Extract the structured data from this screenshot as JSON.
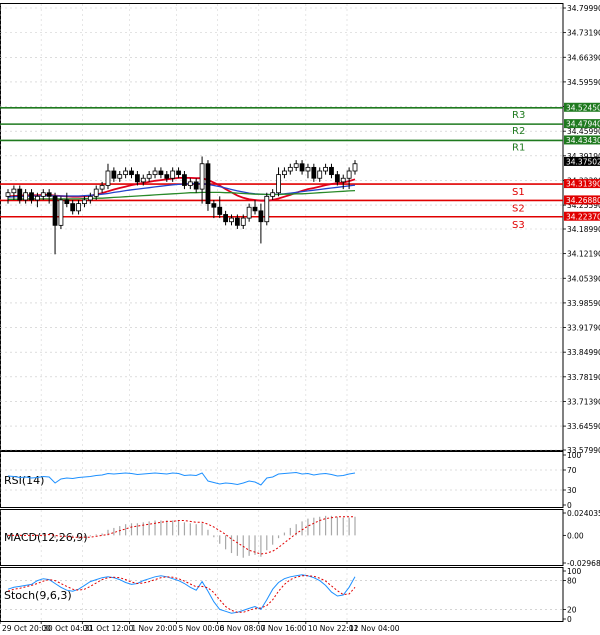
{
  "chart_data": [
    {
      "type": "candlestick",
      "pane": "price",
      "ylim": [
        33.5799,
        34.7999
      ],
      "y_ticks": [
        "34.79990",
        "34.73190",
        "34.66390",
        "34.59590",
        "34.52790",
        "34.45990",
        "34.39190",
        "34.32390",
        "34.25590",
        "34.18990",
        "34.12190",
        "34.05390",
        "33.98590",
        "33.91790",
        "33.84990",
        "33.78190",
        "33.71390",
        "33.64590",
        "33.57990"
      ],
      "x_ticks": [
        "29 Oct 20:00",
        "30 Oct 04:00",
        "31 Oct 12:00",
        "1 Nov 20:00",
        "5 Nov 00:00",
        "6 Nov 08:00",
        "7 Nov 16:00",
        "10 Nov 22:01",
        "12 Nov 04:00"
      ],
      "current_price": "34.37502",
      "candles": [
        [
          34.28,
          34.3,
          34.26,
          34.29
        ],
        [
          34.29,
          34.31,
          34.27,
          34.3
        ],
        [
          34.3,
          34.31,
          34.26,
          34.27
        ],
        [
          34.27,
          34.3,
          34.26,
          34.29
        ],
        [
          34.29,
          34.3,
          34.26,
          34.27
        ],
        [
          34.27,
          34.29,
          34.25,
          34.28
        ],
        [
          34.28,
          34.3,
          34.27,
          34.29
        ],
        [
          34.29,
          34.3,
          34.26,
          34.28
        ],
        [
          34.28,
          34.29,
          34.12,
          34.2
        ],
        [
          34.2,
          34.28,
          34.19,
          34.27
        ],
        [
          34.27,
          34.29,
          34.25,
          34.26
        ],
        [
          34.26,
          34.27,
          34.23,
          34.24
        ],
        [
          34.24,
          34.27,
          34.23,
          34.26
        ],
        [
          34.26,
          34.28,
          34.25,
          34.27
        ],
        [
          34.27,
          34.29,
          34.26,
          34.28
        ],
        [
          34.28,
          34.31,
          34.27,
          34.3
        ],
        [
          34.3,
          34.32,
          34.29,
          34.31
        ],
        [
          34.31,
          34.37,
          34.3,
          34.35
        ],
        [
          34.35,
          34.36,
          34.32,
          34.33
        ],
        [
          34.33,
          34.35,
          34.32,
          34.34
        ],
        [
          34.34,
          34.36,
          34.33,
          34.35
        ],
        [
          34.35,
          34.36,
          34.33,
          34.34
        ],
        [
          34.34,
          34.35,
          34.31,
          34.32
        ],
        [
          34.32,
          34.34,
          34.31,
          34.33
        ],
        [
          34.33,
          34.35,
          34.32,
          34.34
        ],
        [
          34.34,
          34.36,
          34.33,
          34.35
        ],
        [
          34.35,
          34.36,
          34.33,
          34.34
        ],
        [
          34.34,
          34.35,
          34.32,
          34.33
        ],
        [
          34.33,
          34.36,
          34.32,
          34.35
        ],
        [
          34.35,
          34.36,
          34.33,
          34.34
        ],
        [
          34.34,
          34.35,
          34.3,
          34.31
        ],
        [
          34.31,
          34.33,
          34.3,
          34.32
        ],
        [
          34.32,
          34.33,
          34.29,
          34.3
        ],
        [
          34.3,
          34.39,
          34.26,
          34.37
        ],
        [
          34.37,
          34.38,
          34.24,
          34.26
        ],
        [
          34.26,
          34.27,
          34.22,
          34.25
        ],
        [
          34.25,
          34.28,
          34.22,
          34.23
        ],
        [
          34.23,
          34.24,
          34.2,
          34.21
        ],
        [
          34.21,
          34.23,
          34.2,
          34.22
        ],
        [
          34.22,
          34.23,
          34.19,
          34.2
        ],
        [
          34.2,
          34.23,
          34.19,
          34.22
        ],
        [
          34.22,
          34.26,
          34.21,
          34.25
        ],
        [
          34.25,
          34.27,
          34.23,
          34.24
        ],
        [
          34.24,
          34.26,
          34.15,
          34.21
        ],
        [
          34.21,
          34.29,
          34.2,
          34.28
        ],
        [
          34.28,
          34.3,
          34.27,
          34.29
        ],
        [
          34.29,
          34.36,
          34.28,
          34.34
        ],
        [
          34.34,
          34.36,
          34.33,
          34.35
        ],
        [
          34.35,
          34.37,
          34.34,
          34.36
        ],
        [
          34.36,
          34.38,
          34.35,
          34.37
        ],
        [
          34.37,
          34.38,
          34.34,
          34.35
        ],
        [
          34.35,
          34.37,
          34.33,
          34.36
        ],
        [
          34.36,
          34.37,
          34.32,
          34.33
        ],
        [
          34.33,
          34.36,
          34.32,
          34.35
        ],
        [
          34.35,
          34.37,
          34.34,
          34.36
        ],
        [
          34.36,
          34.37,
          34.33,
          34.34
        ],
        [
          34.34,
          34.35,
          34.31,
          34.32
        ],
        [
          34.32,
          34.34,
          34.3,
          34.33
        ],
        [
          34.33,
          34.36,
          34.3,
          34.35
        ],
        [
          34.35,
          34.38,
          34.34,
          34.37
        ]
      ],
      "moving_averages": [
        {
          "color": "#e0001b",
          "values": [
            34.28,
            34.281,
            34.282,
            34.283,
            34.283,
            34.283,
            34.284,
            34.284,
            34.282,
            34.281,
            34.28,
            34.279,
            34.279,
            34.28,
            34.282,
            34.285,
            34.289,
            34.294,
            34.299,
            34.303,
            34.307,
            34.311,
            34.314,
            34.317,
            34.32,
            34.323,
            34.325,
            34.327,
            34.329,
            34.331,
            34.331,
            34.331,
            34.33,
            34.33,
            34.325,
            34.318,
            34.31,
            34.3,
            34.291,
            34.282,
            34.276,
            34.272,
            34.27,
            34.268,
            34.268,
            34.27,
            34.274,
            34.279,
            34.284,
            34.29,
            34.295,
            34.3,
            34.303,
            34.307,
            34.311,
            34.314,
            34.316,
            34.318,
            34.322,
            34.327
          ]
        },
        {
          "color": "#2244cc",
          "values": [
            34.278,
            34.279,
            34.28,
            34.28,
            34.281,
            34.281,
            34.281,
            34.282,
            34.281,
            34.281,
            34.281,
            34.281,
            34.281,
            34.282,
            34.283,
            34.284,
            34.286,
            34.288,
            34.291,
            34.293,
            34.296,
            34.298,
            34.3,
            34.302,
            34.304,
            34.306,
            34.308,
            34.31,
            34.312,
            34.313,
            34.314,
            34.315,
            34.315,
            34.315,
            34.313,
            34.31,
            34.307,
            34.303,
            34.299,
            34.295,
            34.292,
            34.289,
            34.287,
            34.286,
            34.285,
            34.285,
            34.286,
            34.287,
            34.289,
            34.291,
            34.293,
            34.295,
            34.297,
            34.299,
            34.301,
            34.303,
            34.305,
            34.307,
            34.309,
            34.311
          ]
        },
        {
          "color": "#2a8a2a",
          "values": [
            34.272,
            34.272,
            34.272,
            34.273,
            34.273,
            34.273,
            34.273,
            34.273,
            34.273,
            34.273,
            34.273,
            34.273,
            34.273,
            34.274,
            34.274,
            34.275,
            34.275,
            34.276,
            34.277,
            34.278,
            34.279,
            34.28,
            34.281,
            34.282,
            34.283,
            34.284,
            34.285,
            34.286,
            34.287,
            34.288,
            34.289,
            34.29,
            34.29,
            34.291,
            34.291,
            34.291,
            34.291,
            34.29,
            34.29,
            34.289,
            34.288,
            34.287,
            34.286,
            34.286,
            34.285,
            34.285,
            34.285,
            34.286,
            34.286,
            34.287,
            34.287,
            34.288,
            34.289,
            34.29,
            34.291,
            34.292,
            34.293,
            34.294,
            34.295,
            34.296
          ]
        }
      ],
      "levels": [
        {
          "name": "R3",
          "value": "34.52450",
          "color": "#1f7a1f"
        },
        {
          "name": "R2",
          "value": "34.47940",
          "color": "#1f7a1f"
        },
        {
          "name": "R1",
          "value": "34.43430",
          "color": "#1f7a1f"
        },
        {
          "name": "S1",
          "value": "34.31390",
          "color": "#e00000"
        },
        {
          "name": "S2",
          "value": "34.26880",
          "color": "#e00000"
        },
        {
          "name": "S3",
          "value": "34.22370",
          "color": "#e00000"
        }
      ]
    },
    {
      "type": "line",
      "pane": "rsi",
      "label": "RSI(14)",
      "ylim": [
        0,
        100
      ],
      "y_ticks": [
        "100",
        "70",
        "30",
        "0"
      ],
      "series": [
        {
          "color": "#1e90ff",
          "values": [
            58,
            57,
            55,
            56,
            54,
            55,
            57,
            56,
            44,
            52,
            54,
            53,
            55,
            56,
            57,
            59,
            60,
            63,
            62,
            63,
            64,
            63,
            61,
            62,
            63,
            64,
            63,
            62,
            64,
            63,
            59,
            60,
            59,
            64,
            48,
            45,
            42,
            44,
            43,
            41,
            44,
            48,
            46,
            40,
            54,
            56,
            62,
            63,
            64,
            65,
            62,
            63,
            60,
            62,
            63,
            61,
            58,
            59,
            62,
            64
          ]
        }
      ]
    },
    {
      "type": "bar+line",
      "pane": "macd",
      "label": "MACD(12,26,9)",
      "ylim": [
        -0.029687,
        0.024035
      ],
      "y_ticks": [
        "0.024035",
        "0.00",
        "-0.029687"
      ],
      "histogram": [
        0.0,
        0.0,
        0.001,
        0.0,
        0.0,
        0.0,
        0.001,
        0.001,
        -0.003,
        -0.002,
        -0.002,
        -0.003,
        -0.003,
        -0.002,
        -0.001,
        0.001,
        0.002,
        0.006,
        0.008,
        0.01,
        0.012,
        0.013,
        0.013,
        0.014,
        0.015,
        0.016,
        0.016,
        0.016,
        0.016,
        0.016,
        0.014,
        0.013,
        0.012,
        0.013,
        0.006,
        -0.002,
        -0.009,
        -0.015,
        -0.019,
        -0.022,
        -0.024,
        -0.022,
        -0.021,
        -0.023,
        -0.016,
        -0.01,
        -0.003,
        0.003,
        0.008,
        0.012,
        0.015,
        0.018,
        0.019,
        0.02,
        0.021,
        0.021,
        0.02,
        0.019,
        0.019,
        0.02
      ],
      "signal": {
        "color": "#e00000",
        "values": [
          0.0,
          0.0,
          0.0,
          0.0,
          0.0,
          0.0,
          0.0,
          0.001,
          0.0,
          -0.001,
          -0.001,
          -0.002,
          -0.002,
          -0.002,
          -0.002,
          -0.001,
          0.0,
          0.001,
          0.003,
          0.005,
          0.007,
          0.009,
          0.01,
          0.011,
          0.012,
          0.013,
          0.014,
          0.015,
          0.015,
          0.016,
          0.016,
          0.015,
          0.014,
          0.014,
          0.012,
          0.009,
          0.005,
          0.001,
          -0.004,
          -0.008,
          -0.012,
          -0.016,
          -0.018,
          -0.02,
          -0.019,
          -0.017,
          -0.013,
          -0.008,
          -0.003,
          0.002,
          0.006,
          0.01,
          0.013,
          0.016,
          0.018,
          0.019,
          0.02,
          0.02,
          0.02,
          0.02
        ]
      }
    },
    {
      "type": "line",
      "pane": "stochastic",
      "label": "Stoch(9,6,3)",
      "ylim": [
        0,
        100
      ],
      "y_ticks": [
        "100",
        "80",
        "20",
        "0"
      ],
      "series": [
        {
          "color": "#1e90ff",
          "values": [
            62,
            66,
            68,
            70,
            72,
            80,
            84,
            82,
            74,
            66,
            60,
            58,
            62,
            70,
            78,
            82,
            86,
            88,
            86,
            82,
            76,
            72,
            74,
            80,
            84,
            88,
            90,
            88,
            84,
            80,
            74,
            66,
            60,
            78,
            58,
            36,
            20,
            16,
            12,
            14,
            18,
            22,
            26,
            20,
            40,
            62,
            76,
            84,
            88,
            90,
            92,
            90,
            86,
            80,
            70,
            56,
            48,
            50,
            66,
            88
          ]
        },
        {
          "color": "#e00000",
          "values": [
            58,
            62,
            64,
            67,
            70,
            74,
            79,
            82,
            80,
            74,
            68,
            62,
            60,
            62,
            68,
            75,
            82,
            86,
            87,
            86,
            82,
            77,
            74,
            75,
            78,
            82,
            86,
            88,
            87,
            84,
            79,
            73,
            67,
            68,
            65,
            55,
            40,
            26,
            18,
            14,
            14,
            18,
            22,
            23,
            28,
            40,
            58,
            72,
            82,
            87,
            90,
            90,
            89,
            85,
            79,
            69,
            59,
            51,
            52,
            66
          ]
        }
      ]
    }
  ]
}
